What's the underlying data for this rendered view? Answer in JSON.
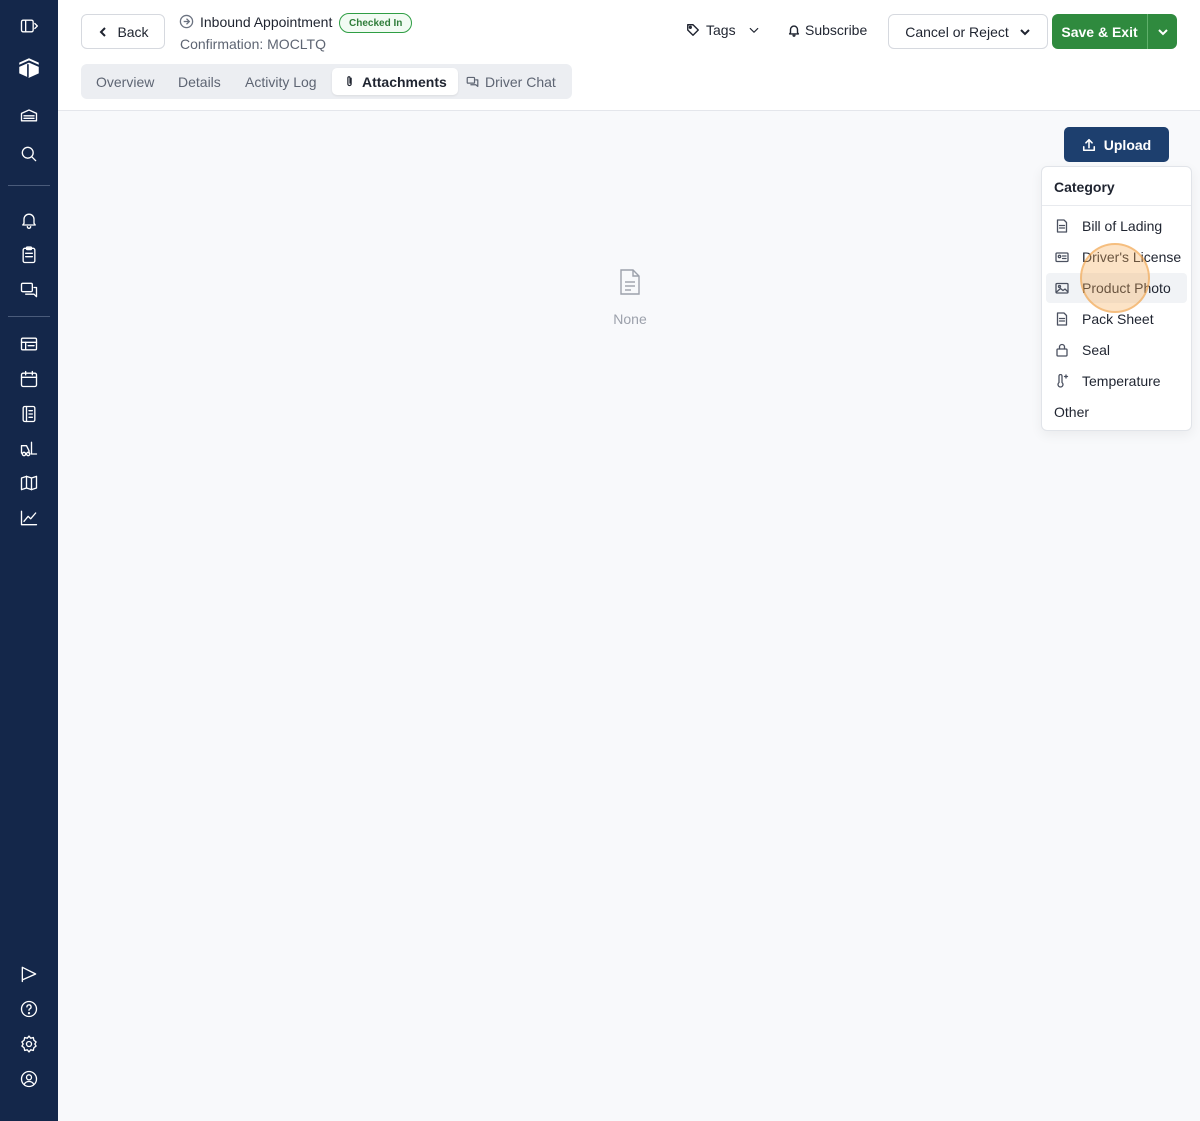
{
  "sidebar": {
    "icons": [
      "sidebar-toggle-icon",
      "logo-icon",
      "warehouse-icon",
      "search-icon",
      "bell-icon",
      "clipboard-icon",
      "chat-icon",
      "dock-board-icon",
      "calendar-icon",
      "schedule-icon",
      "forklift-icon",
      "map-icon",
      "chart-icon",
      "flag-icon",
      "help-icon",
      "settings-icon",
      "user-icon"
    ]
  },
  "header": {
    "back_label": "Back",
    "title": "Inbound Appointment",
    "status_badge": "Checked In",
    "confirmation": "Confirmation: MOCLTQ",
    "tags_label": "Tags",
    "subscribe_label": "Subscribe",
    "cancel_label": "Cancel or Reject",
    "save_label": "Save & Exit",
    "tabs": [
      {
        "label": "Overview",
        "active": false
      },
      {
        "label": "Details",
        "active": false
      },
      {
        "label": "Activity Log",
        "active": false
      },
      {
        "label": "Attachments",
        "active": true
      },
      {
        "label": "Driver Chat",
        "active": false
      }
    ]
  },
  "main": {
    "empty_text": "None",
    "upload_label": "Upload"
  },
  "category_menu": {
    "header": "Category",
    "hovered": "Product Photo",
    "items": [
      {
        "label": "Bill of Lading",
        "icon": "document-icon"
      },
      {
        "label": "Driver's License",
        "icon": "id-card-icon"
      },
      {
        "label": "Product Photo",
        "icon": "image-icon"
      },
      {
        "label": "Pack Sheet",
        "icon": "document-icon"
      },
      {
        "label": "Seal",
        "icon": "lock-icon"
      },
      {
        "label": "Temperature",
        "icon": "thermometer-icon"
      },
      {
        "label": "Other",
        "icon": ""
      }
    ]
  },
  "colors": {
    "sidebar_bg": "#14274a",
    "save_green": "#2f8a3e",
    "upload_blue": "#1d3f6e",
    "badge_green": "#2f9e44"
  }
}
